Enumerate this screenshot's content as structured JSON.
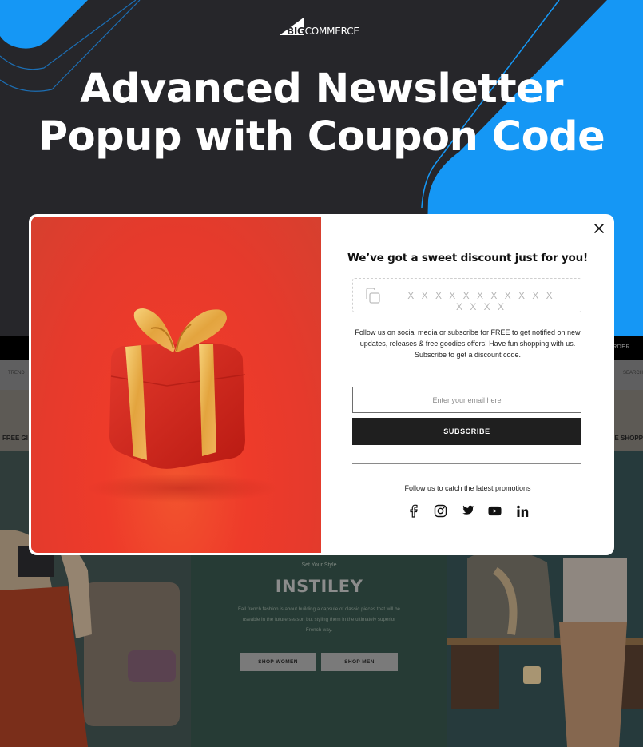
{
  "banner": {
    "logo": {
      "part1": "BIG",
      "part2": "COMMERCE"
    },
    "headline_line1": "Advanced Newsletter",
    "headline_line2": "Popup with Coupon Code",
    "colors": {
      "background": "#26262a",
      "accent": "#1597f5"
    }
  },
  "store": {
    "topbar_right": "ORDER",
    "nav_left": "TREND",
    "nav_right": "SEARCH",
    "promo_left": "FREE GI",
    "promo_right": "E SHOPP",
    "hero": {
      "eyebrow": "Set Your Style",
      "brand": "INSTILEY",
      "description": "Fall french fashion is about building a capsule of classic pieces that will be useable in the future season but styling them in the ultimately superior French way.",
      "buttons": [
        "SHOP WOMEN",
        "SHOP MEN"
      ]
    }
  },
  "popup": {
    "image_alt": "Red gift box with gold ribbon",
    "title": "We’ve got a sweet discount just for you!",
    "coupon_code": "XXXXXXXXXXXXXXX",
    "copy_icon": "copy-icon",
    "message_line1": "Follow us on social media or subscribe for FREE to get notified on new updates, releases & free goodies offers! Have fun shopping with us.",
    "message_line2": "Subscribe to get a discount code.",
    "email": {
      "value": "",
      "placeholder": "Enter your email here"
    },
    "subscribe_label": "SUBSCRIBE",
    "follow_text": "Follow us to catch the latest promotions",
    "socials": [
      "facebook-icon",
      "instagram-icon",
      "twitter-icon",
      "youtube-icon",
      "linkedin-icon"
    ],
    "close_icon": "close-icon",
    "colors": {
      "button": "#1f1f1f",
      "image_bg": "#ee3b2a",
      "ribbon": "#e9b04a"
    }
  }
}
